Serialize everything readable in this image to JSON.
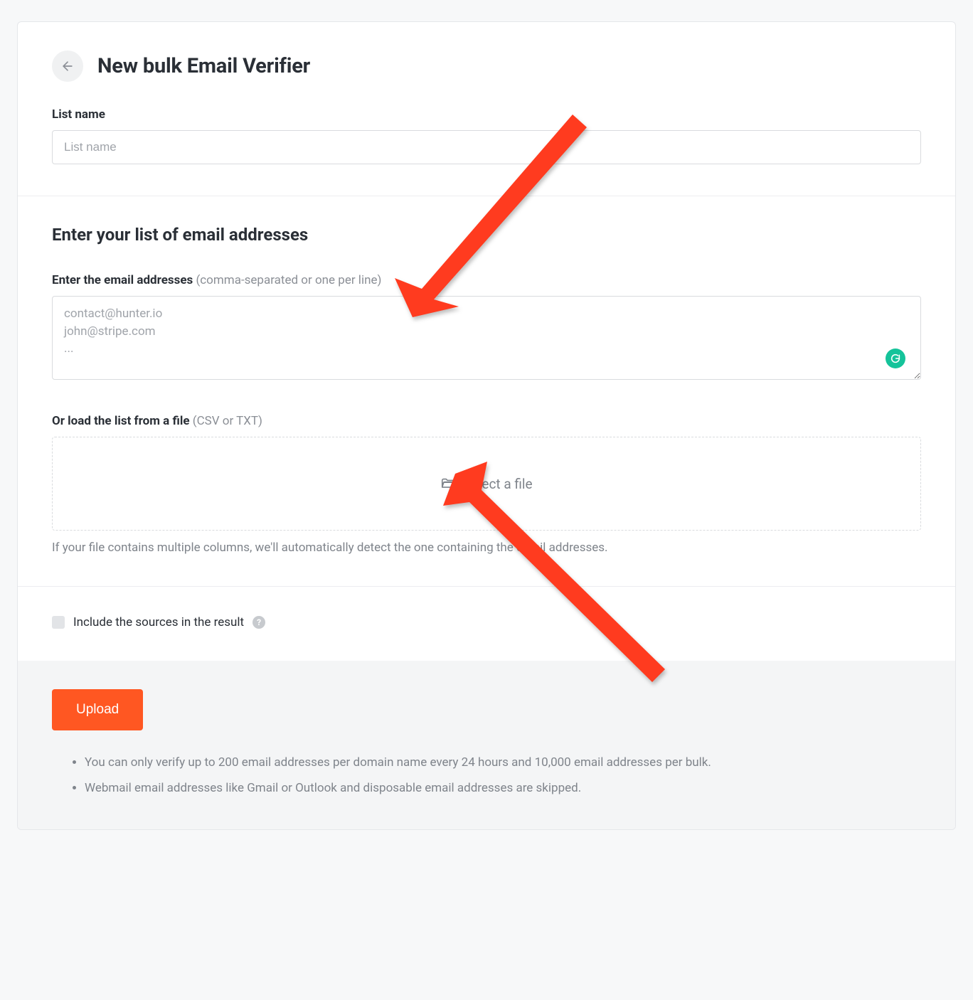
{
  "header": {
    "title": "New bulk Email Verifier"
  },
  "listName": {
    "label": "List name",
    "placeholder": "List name"
  },
  "emailSection": {
    "heading": "Enter your list of email addresses",
    "textareaLabel": "Enter the email addresses",
    "textareaHint": " (comma-separated or one per line)",
    "textareaPlaceholder": "contact@hunter.io\njohn@stripe.com\n...",
    "fileLabel": "Or load the list from a file",
    "fileHint": " (CSV or TXT)",
    "selectFile": "Select a file",
    "fileHelp": "If your file contains multiple columns, we'll automatically detect the one containing the email addresses."
  },
  "options": {
    "includeSourcesLabel": "Include the sources in the result"
  },
  "footer": {
    "uploadLabel": "Upload",
    "notes": [
      "You can only verify up to 200 email addresses per domain name every 24 hours and 10,000 email addresses per bulk.",
      "Webmail email addresses like Gmail or Outlook and disposable email addresses are skipped."
    ]
  },
  "annotation": {
    "arrowColor": "#ff3b1f"
  }
}
